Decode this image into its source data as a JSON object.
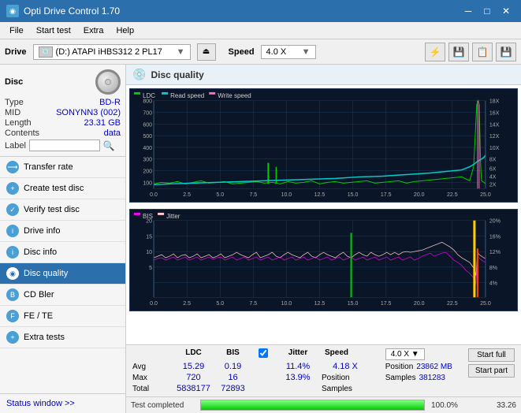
{
  "app": {
    "title": "Opti Drive Control 1.70",
    "icon": "◉"
  },
  "titlebar": {
    "minimize": "─",
    "maximize": "□",
    "close": "✕"
  },
  "menubar": {
    "items": [
      "File",
      "Start test",
      "Extra",
      "Help"
    ]
  },
  "drivebar": {
    "label": "Drive",
    "drive_value": "(D:) ATAPI iHBS312  2 PL17",
    "speed_label": "Speed",
    "speed_value": "4.0 X"
  },
  "disc": {
    "type_label": "Type",
    "type_value": "BD-R",
    "mid_label": "MID",
    "mid_value": "SONYNN3 (002)",
    "length_label": "Length",
    "length_value": "23.31 GB",
    "contents_label": "Contents",
    "contents_value": "data",
    "label_label": "Label"
  },
  "nav": {
    "items": [
      {
        "id": "transfer-rate",
        "label": "Transfer rate",
        "active": false
      },
      {
        "id": "create-test-disc",
        "label": "Create test disc",
        "active": false
      },
      {
        "id": "verify-test-disc",
        "label": "Verify test disc",
        "active": false
      },
      {
        "id": "drive-info",
        "label": "Drive info",
        "active": false
      },
      {
        "id": "disc-info",
        "label": "Disc info",
        "active": false
      },
      {
        "id": "disc-quality",
        "label": "Disc quality",
        "active": true
      },
      {
        "id": "cd-bler",
        "label": "CD Bler",
        "active": false
      },
      {
        "id": "fe-te",
        "label": "FE / TE",
        "active": false
      },
      {
        "id": "extra-tests",
        "label": "Extra tests",
        "active": false
      }
    ]
  },
  "status_window": {
    "label": "Status window >>"
  },
  "content": {
    "title": "Disc quality",
    "icon": "💿"
  },
  "chart_top": {
    "legend": [
      "LDC",
      "Read speed",
      "Write speed"
    ],
    "y_left_max": 800,
    "y_right_labels": [
      "18X",
      "16X",
      "14X",
      "12X",
      "10X",
      "8X",
      "6X",
      "4X",
      "2X"
    ],
    "x_labels": [
      "0.0",
      "2.5",
      "5.0",
      "7.5",
      "10.0",
      "12.5",
      "15.0",
      "17.5",
      "20.0",
      "22.5",
      "25.0"
    ]
  },
  "chart_bottom": {
    "legend": [
      "BIS",
      "Jitter"
    ],
    "y_left_max": 20,
    "y_right_labels": [
      "20%",
      "16%",
      "12%",
      "8%",
      "4%"
    ],
    "x_labels": [
      "0.0",
      "2.5",
      "5.0",
      "7.5",
      "10.0",
      "12.5",
      "15.0",
      "17.5",
      "20.0",
      "22.5",
      "25.0"
    ]
  },
  "stats": {
    "headers": [
      "LDC",
      "BIS",
      "Jitter",
      "Speed",
      ""
    ],
    "avg_label": "Avg",
    "max_label": "Max",
    "total_label": "Total",
    "ldc_avg": "15.29",
    "ldc_max": "720",
    "ldc_total": "5838177",
    "bis_avg": "0.19",
    "bis_max": "16",
    "bis_total": "72893",
    "jitter_avg": "11.4%",
    "jitter_max": "13.9%",
    "jitter_label": "Jitter",
    "speed_value": "4.18 X",
    "speed_label": "4.0 X",
    "position_label": "Position",
    "position_value": "23862 MB",
    "samples_label": "Samples",
    "samples_value": "381283",
    "start_full": "Start full",
    "start_part": "Start part"
  },
  "progress": {
    "status": "Test completed",
    "percent": 100,
    "percent_label": "100.0%",
    "speed": "33.26"
  },
  "colors": {
    "ldc": "#00cc00",
    "bis": "#ff00ff",
    "jitter": "#ffcccc",
    "read_speed": "#00cccc",
    "grid": "#1a2a4a",
    "bg": "#0a1628",
    "accent": "#2c6fad"
  }
}
